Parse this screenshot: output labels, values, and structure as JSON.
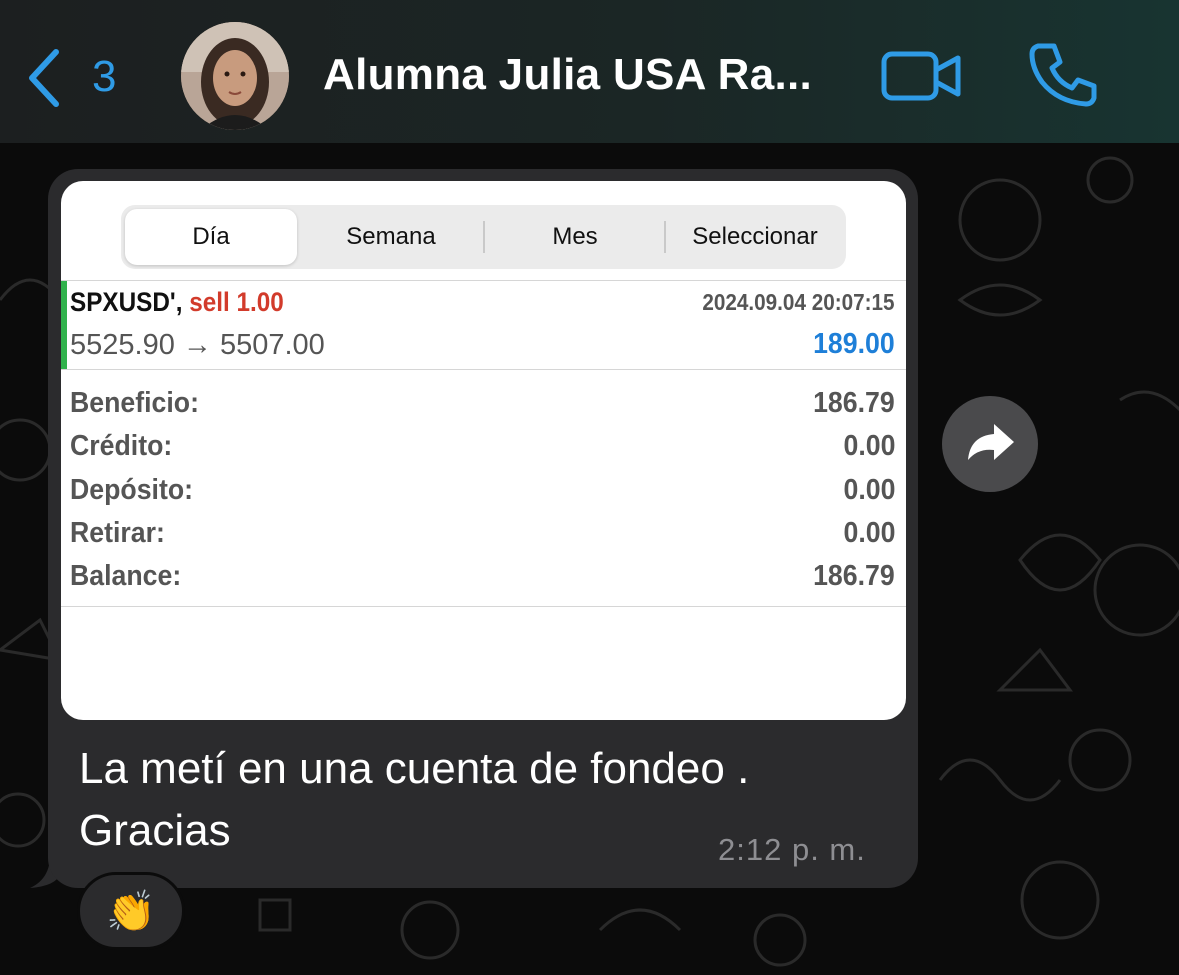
{
  "header": {
    "unread_count": "3",
    "contact_name": "Alumna Julia USA Ra...",
    "accent_color": "#2f9be6"
  },
  "screenshot": {
    "tabs": [
      {
        "label": "Día",
        "active": true
      },
      {
        "label": "Semana",
        "active": false
      },
      {
        "label": "Mes",
        "active": false
      },
      {
        "label": "Seleccionar",
        "active": false
      }
    ],
    "trade": {
      "symbol": "SPXUSD',",
      "action": "sell 1.00",
      "datetime": "2024.09.04 20:07:15",
      "prices": "5525.90 → 5507.00",
      "profit": "189.00"
    },
    "summary": [
      {
        "label": "Beneficio:",
        "value": "186.79"
      },
      {
        "label": "Crédito:",
        "value": "0.00"
      },
      {
        "label": "Depósito:",
        "value": "0.00"
      },
      {
        "label": "Retirar:",
        "value": "0.00"
      },
      {
        "label": "Balance:",
        "value": "186.79"
      }
    ]
  },
  "message": {
    "text_line1": "La metí en una cuenta de fondeo .",
    "text_line2": "Gracias",
    "time": "2:12 p. m.",
    "reaction": "👏"
  },
  "icons": [
    "back-chevron-icon",
    "video-call-icon",
    "phone-icon",
    "forward-icon"
  ]
}
